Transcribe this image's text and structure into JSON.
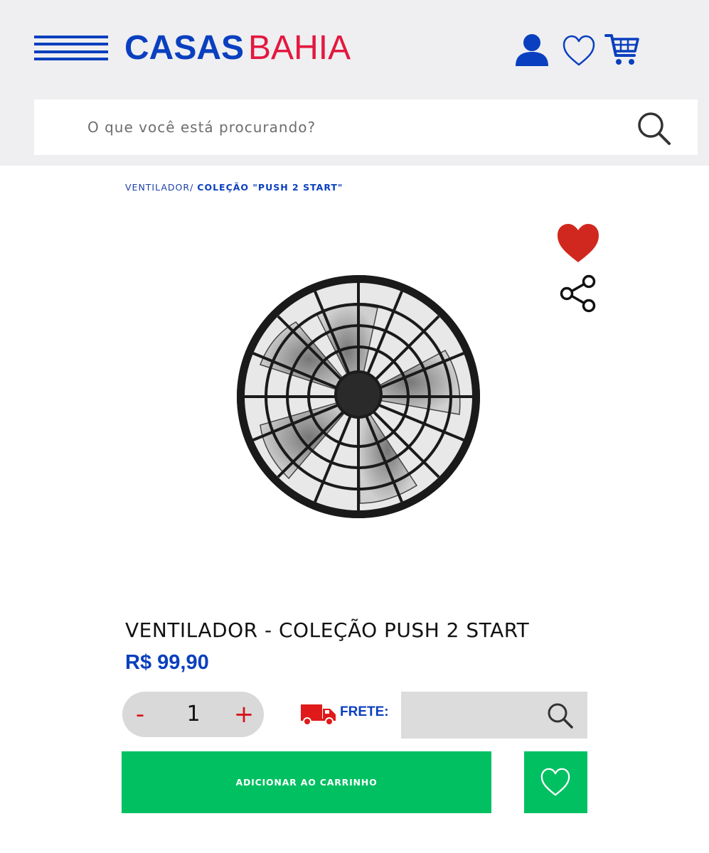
{
  "header": {
    "brand_part1": "CASAS",
    "brand_part2": "BAHIA",
    "search_placeholder": "O que você está procurando?"
  },
  "icons": {
    "menu": "hamburger-menu-icon",
    "account": "user-icon",
    "wishlist": "heart-outline-icon",
    "cart": "cart-icon",
    "search": "search-icon",
    "favorite": "heart-filled-icon",
    "share": "share-icon",
    "shipping": "truck-icon"
  },
  "breadcrumb": {
    "items": [
      "VENTILADOR/"
    ],
    "current": "COLEÇÃO \"PUSH 2 START\""
  },
  "product": {
    "title": "VENTILADOR - COLEÇÃO PUSH 2 START",
    "price": "R$ 99,90",
    "quantity": "1",
    "qty_minus": "-",
    "qty_plus": "+",
    "favorited": true
  },
  "shipping": {
    "label": "FRETE:",
    "value": ""
  },
  "actions": {
    "add_to_cart": "ADICIONAR AO CARRINHO"
  },
  "colors": {
    "brand_blue": "#0a3fbf",
    "brand_red": "#e3183f",
    "cta_green": "#00c062",
    "favorite_red": "#d0281f",
    "header_bg": "#efeff1"
  }
}
